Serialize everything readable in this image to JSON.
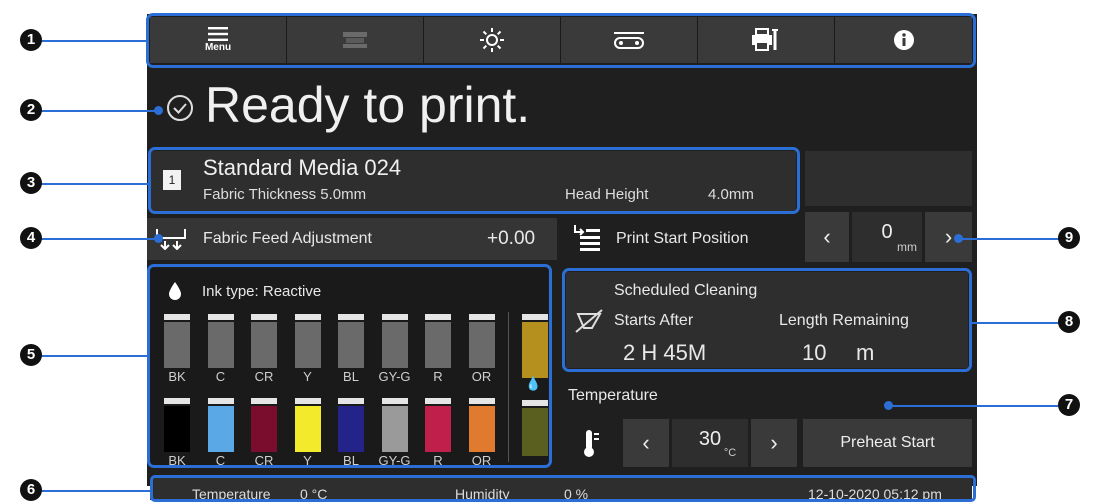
{
  "toolbar": {
    "menu_label": "Menu",
    "icons": [
      "menu-icon",
      "media-feed-icon",
      "brightness-icon",
      "conveyor-icon",
      "printer-maintenance-icon",
      "info-icon"
    ]
  },
  "status": {
    "text": "Ready to print."
  },
  "media": {
    "number": "1",
    "name": "Standard Media 024",
    "thickness_label": "Fabric Thickness 5.0mm",
    "head_height_label": "Head Height",
    "head_height_value": "4.0mm"
  },
  "feed": {
    "label": "Fabric Feed Adjustment",
    "value": "+0.00"
  },
  "print_start": {
    "label": "Print Start Position",
    "value": "0",
    "unit": "mm"
  },
  "ink": {
    "type_label": "Ink type: Reactive",
    "row1": [
      {
        "label": "BK",
        "color": "#6a6a6a"
      },
      {
        "label": "C",
        "color": "#6a6a6a"
      },
      {
        "label": "CR",
        "color": "#6a6a6a"
      },
      {
        "label": "Y",
        "color": "#6a6a6a"
      },
      {
        "label": "BL",
        "color": "#6a6a6a"
      },
      {
        "label": "GY-G",
        "color": "#6a6a6a"
      },
      {
        "label": "R",
        "color": "#6a6a6a"
      },
      {
        "label": "OR",
        "color": "#6a6a6a"
      }
    ],
    "row2": [
      {
        "label": "BK",
        "color": "#000000"
      },
      {
        "label": "C",
        "color": "#5aa9e6"
      },
      {
        "label": "CR",
        "color": "#7a0d2e"
      },
      {
        "label": "Y",
        "color": "#f2ea2a"
      },
      {
        "label": "BL",
        "color": "#23238a"
      },
      {
        "label": "GY-G",
        "color": "#9a9a9a"
      },
      {
        "label": "R",
        "color": "#c01f4c"
      },
      {
        "label": "OR",
        "color": "#e07a2e"
      }
    ],
    "extra_top_color": "#b5901f",
    "extra_bottom_color": "#5a5e1f"
  },
  "cleaning": {
    "title": "Scheduled Cleaning",
    "starts_after_label": "Starts After",
    "length_label": "Length Remaining",
    "starts_after_value": "2 H 45M",
    "length_value": "10",
    "length_unit": "m"
  },
  "temperature": {
    "label": "Temperature",
    "value": "30",
    "unit": "°C",
    "preheat_label": "Preheat Start"
  },
  "footer": {
    "temp_label": "Temperature",
    "temp_value": "0 °C",
    "humidity_label": "Humidity",
    "humidity_value": "0 %",
    "datetime": "12-10-2020 05:12 pm"
  },
  "callouts": [
    "1",
    "2",
    "3",
    "4",
    "5",
    "6",
    "7",
    "8",
    "9"
  ],
  "colors": {
    "accent": "#2b6fd6",
    "panel": "#1f1f1f",
    "button": "#3a3a3a"
  }
}
